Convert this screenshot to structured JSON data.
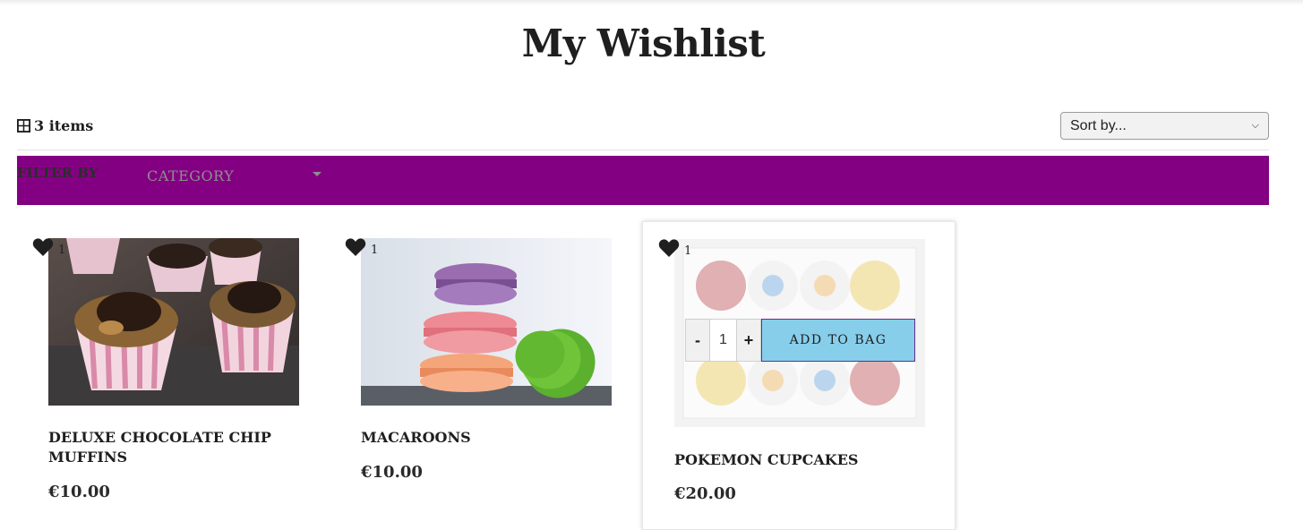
{
  "page": {
    "title": "My Wishlist"
  },
  "toolbar": {
    "items_count": "3 items",
    "sort_label": "Sort by..."
  },
  "filter": {
    "label": "FILTER BY",
    "category": "CATEGORY",
    "bar_color": "#840082"
  },
  "products": [
    {
      "name": "DELUXE CHOCOLATE CHIP MUFFINS",
      "price": "€10.00",
      "wish_count": "1"
    },
    {
      "name": "MACAROONS",
      "price": "€10.00",
      "wish_count": "1"
    },
    {
      "name": "POKEMON CUPCAKES",
      "price": "€20.00",
      "wish_count": "1",
      "quantity": "1",
      "minus_label": "-",
      "plus_label": "+",
      "add_to_bag_label": "ADD TO BAG"
    }
  ],
  "colors": {
    "add_to_bag_bg": "#87ceeb",
    "heart": "#1f1f1f"
  },
  "icons": {
    "items": "grid-icon",
    "wishlist": "heart-icon",
    "sort": "chevron-down-icon",
    "filter": "caret-down-icon"
  }
}
